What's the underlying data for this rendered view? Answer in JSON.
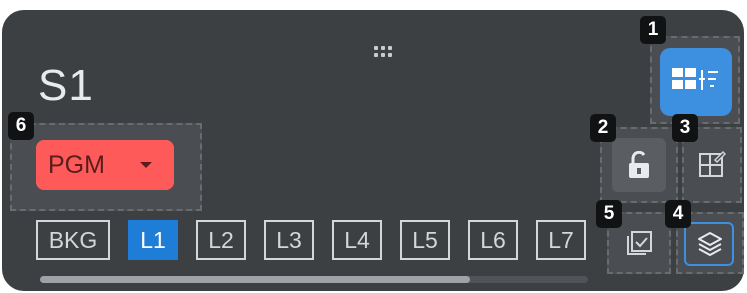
{
  "panel": {
    "title": "S1"
  },
  "output_selector": {
    "value": "PGM"
  },
  "layers": [
    {
      "label": "BKG",
      "active": false
    },
    {
      "label": "L1",
      "active": true
    },
    {
      "label": "L2",
      "active": false
    },
    {
      "label": "L3",
      "active": false
    },
    {
      "label": "L4",
      "active": false
    },
    {
      "label": "L5",
      "active": false
    },
    {
      "label": "L6",
      "active": false
    },
    {
      "label": "L7",
      "active": false
    }
  ],
  "badges": {
    "b1": "1",
    "b2": "2",
    "b3": "3",
    "b4": "4",
    "b5": "5",
    "b6": "6"
  },
  "icons": {
    "drag": "drag-handle-icon",
    "main": "layout-settings-icon",
    "lock": "unlock-icon",
    "layout": "layout-edit-icon",
    "copy": "copy-check-icon",
    "stack": "layers-icon"
  },
  "colors": {
    "panel_bg": "#3c4043",
    "accent_blue": "#3d8fe0",
    "pgm_red": "#ff5a5a",
    "active_layer": "#1e7dd6"
  }
}
